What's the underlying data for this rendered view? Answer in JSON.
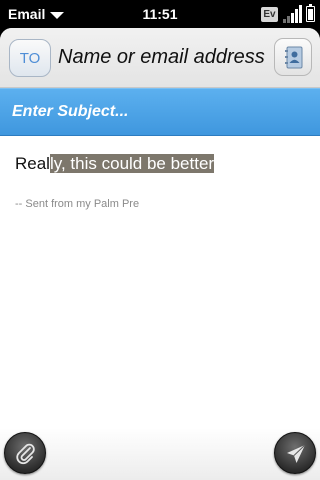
{
  "status_bar": {
    "app_name": "Email",
    "time": "11:51",
    "network_badge": "Ev",
    "icons": [
      "app-menu-caret-icon",
      "signal-icon",
      "battery-icon"
    ]
  },
  "compose": {
    "to_label": "TO",
    "to_placeholder": "Name or email address",
    "subject_placeholder": "Enter Subject...",
    "body": {
      "text_before_selection": "Real",
      "selected_text": "ly, this could be better"
    },
    "signature": "-- Sent from my Palm Pre"
  },
  "toolbar": {
    "icons": [
      "contacts-icon",
      "attach-icon",
      "send-icon"
    ]
  },
  "colors": {
    "subject_bar": "#4aa3e6",
    "to_label": "#4f8ed6",
    "selection": "#7d776c"
  }
}
